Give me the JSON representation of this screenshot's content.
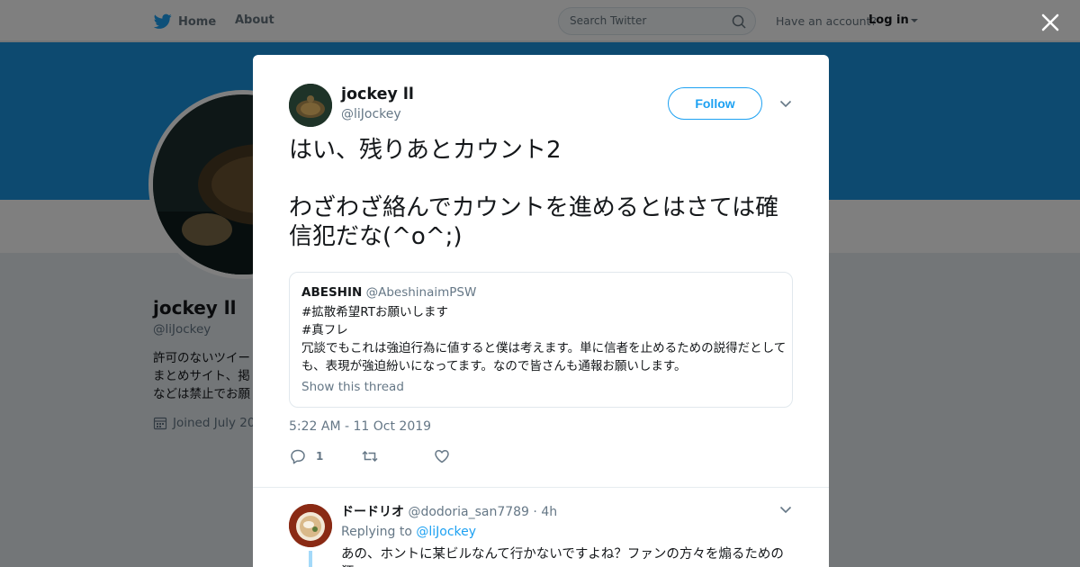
{
  "nav": {
    "home_label": "Home",
    "about_label": "About",
    "search_placeholder": "Search Twitter",
    "have_account": "Have an account?",
    "login_label": "Log in"
  },
  "profile": {
    "name": "jockey ll",
    "handle": "@liJockey",
    "bio_lines": [
      "許可のないツイー",
      "まとめサイト、掲",
      "などは禁止でお願"
    ],
    "joined": "Joined July 20"
  },
  "tweet": {
    "author_name": "jockey ll",
    "author_handle": "@liJockey",
    "follow_label": "Follow",
    "text": "はい、残りあとカウント2\n\nわざわざ絡んでカウントを進めるとはさては確信犯だな(^o^;)",
    "timestamp": "5:22 AM - 11 Oct 2019",
    "reply_count": "1"
  },
  "quoted": {
    "name": "ABESHIN",
    "handle": "@AbeshinaimPSW",
    "text": "#拡散希望RTお願いします\n#真フレ\n冗談でもこれは強迫行為に値すると僕は考えます。単に信者を止めるための説得だとしても、表現が強迫紛いになってます。なので皆さんも通報お願いします。",
    "show_thread": "Show this thread"
  },
  "reply": {
    "name": "ドードリオ",
    "handle": "@dodoria_san7789",
    "time": "· 4h",
    "replying_prefix": "Replying to",
    "replying_to": "@liJockey",
    "text": "あの、ホントに某ビルなんて行かないですよね？ファンの方々を煽るための狂"
  },
  "icons": {
    "brand": "twitter-bird-icon",
    "search": "search-icon",
    "close": "close-icon",
    "reply": "reply-icon",
    "retweet": "retweet-icon",
    "like": "heart-icon",
    "more": "chevron-down-icon",
    "calendar": "calendar-icon"
  },
  "colors": {
    "accent": "#1da1f2",
    "banner": "#1b95e0",
    "muted": "#657786"
  }
}
